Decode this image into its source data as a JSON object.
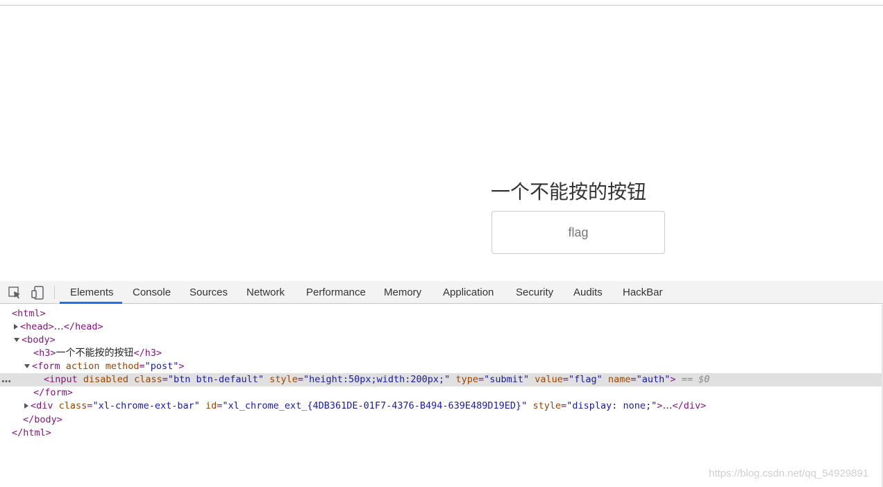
{
  "page": {
    "heading": "一个不能按的按钮",
    "button_label": "flag"
  },
  "devtools": {
    "tabs": [
      {
        "label": "Elements",
        "active": true
      },
      {
        "label": "Console"
      },
      {
        "label": "Sources"
      },
      {
        "label": "Network"
      },
      {
        "label": "Performance"
      },
      {
        "label": "Memory"
      },
      {
        "label": "Application"
      },
      {
        "label": "Security"
      },
      {
        "label": "Audits"
      },
      {
        "label": "HackBar"
      }
    ],
    "icons": {
      "inspect": "cursor-select-icon",
      "device": "device-toolbar-icon"
    },
    "accent_color": "#1a73e8",
    "dom": {
      "html_open": "<html>",
      "head": {
        "open": "<head>",
        "ellipsis": "…",
        "close": "</head>"
      },
      "body_open": "<body>",
      "h3": {
        "open": "<h3>",
        "text": "一个不能按的按钮",
        "close": "</h3>"
      },
      "form": {
        "open_lt": "<form",
        "attr_action": "action",
        "attr_method": "method",
        "eq": "=",
        "val_method": "\"post\"",
        "gt": ">",
        "close": "</form>"
      },
      "input": {
        "lt": "<input",
        "attr_disabled": "disabled",
        "attr_class": "class",
        "val_class": "\"btn btn-default\"",
        "attr_style": "style",
        "val_style": "\"height:50px;width:200px;\"",
        "attr_type": "type",
        "val_type": "\"submit\"",
        "attr_value": "value",
        "val_value": "\"flag\"",
        "attr_name": "name",
        "val_name": "\"auth\"",
        "gt": ">",
        "eq_sel": "== $0",
        "dots": "…"
      },
      "div": {
        "lt": "<div",
        "attr_class": "class",
        "val_class": "\"xl-chrome-ext-bar\"",
        "attr_id": "id",
        "val_id": "\"xl_chrome_ext_{4DB361DE-01F7-4376-B494-639E489D19ED}\"",
        "attr_style": "style",
        "val_style": "\"display: none;\"",
        "gt": ">",
        "ellipsis": "…",
        "close": "</div>"
      },
      "body_close": "</body>",
      "html_close": "</html>"
    }
  },
  "watermark": "https://blog.csdn.net/qq_54929891"
}
